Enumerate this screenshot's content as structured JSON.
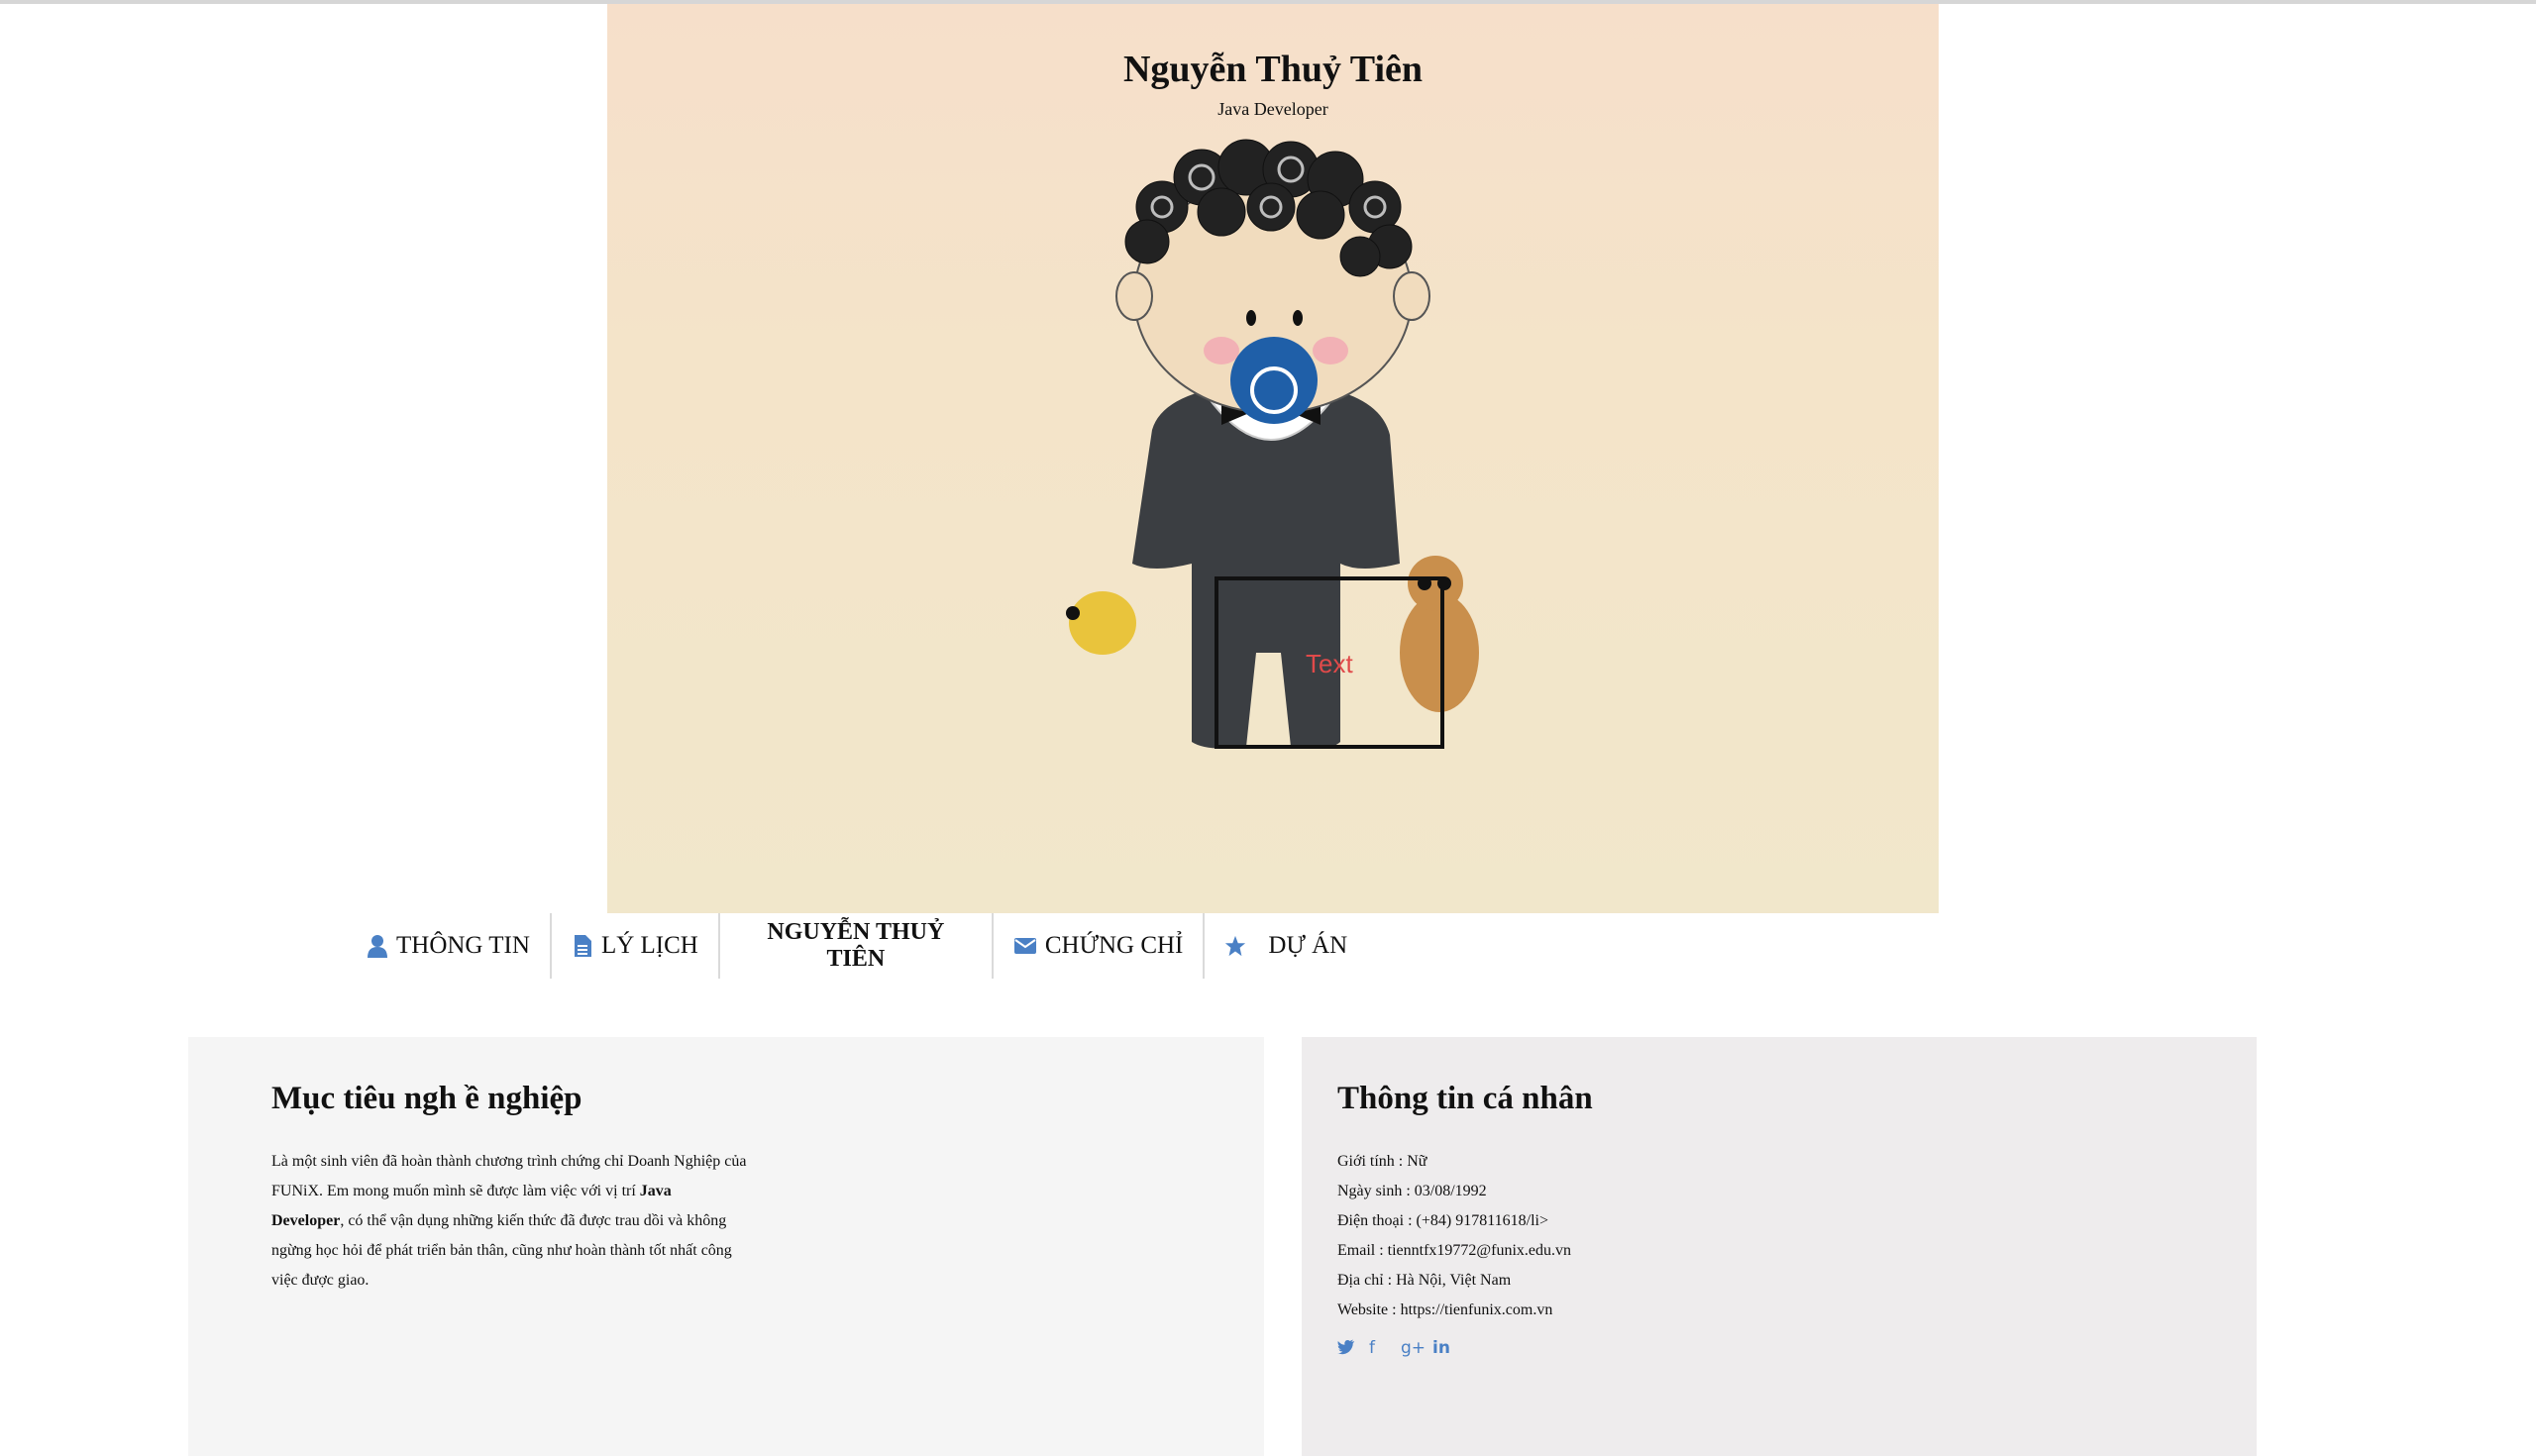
{
  "hero": {
    "name": "Nguyễn Thuỷ Tiên",
    "role": "Java Developer",
    "image_text": "Text"
  },
  "nav": {
    "items": [
      {
        "label": "THÔNG TIN",
        "icon": "user-icon"
      },
      {
        "label": "LÝ LỊCH",
        "icon": "document-icon"
      },
      {
        "label": "NGUYỄN THUỶ TIÊN",
        "icon": ""
      },
      {
        "label": "CHỨNG CHỈ",
        "icon": "envelope-icon"
      },
      {
        "label": "DỰ ÁN",
        "icon": "star-icon"
      }
    ]
  },
  "objective": {
    "title": "Mục tiêu ngh ề nghiệp",
    "text_1": "Là một sinh viên đã hoàn thành chương trình chứng chỉ Doanh Nghiệp của FUNiX. Em mong muốn mình sẽ được làm việc với vị trí ",
    "bold": "Java Developer",
    "text_2": ", có thể vận dụng những kiến thức đã được trau dồi và không ngừng học hỏi để phát triển bản thân, cũng như hoàn thành tốt nhất công việc được giao."
  },
  "personal": {
    "title": "Thông tin cá nhân",
    "lines": [
      "Giới tính : Nữ",
      "Ngày sinh : 03/08/1992",
      "Điện thoại : (+84) 917811618/li>",
      "Email : tienntfx19772@funix.edu.vn",
      "Địa chỉ : Hà Nội, Việt Nam",
      "Website : https://tienfunix.com.vn"
    ],
    "social": [
      {
        "icon": "twitter-icon",
        "glyph": "🐦"
      },
      {
        "icon": "facebook-icon",
        "glyph": "f"
      },
      {
        "icon": "google-plus-icon",
        "glyph": "g+"
      },
      {
        "icon": "linkedin-icon",
        "glyph": "in"
      }
    ]
  },
  "colors": {
    "accent": "#4a80c5",
    "left_panel_bg": "#f5f5f5",
    "right_panel_bg": "#eeeced"
  }
}
